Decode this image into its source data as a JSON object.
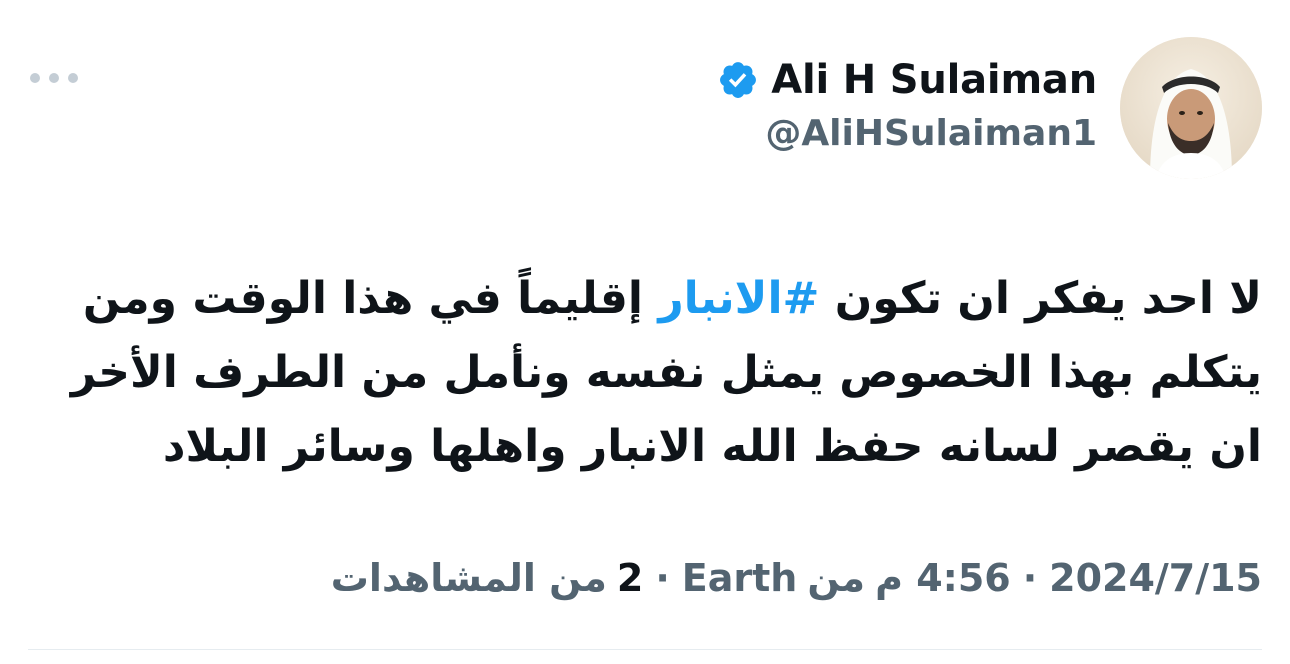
{
  "user": {
    "display_name": "Ali H Sulaiman",
    "handle": "@AliHSulaiman1",
    "verified": true,
    "verified_icon": "verified-badge-icon"
  },
  "tweet": {
    "text_line1_before": "لا احد يفكر ان تكون ",
    "hashtag": "#الانبار",
    "text_line1_after": " إقليماً في هذا الوقت ومن",
    "text_line2": "يتكلم بهذا الخصوص يمثل نفسه ونأمل من الطرف الأخر",
    "text_line3": "ان يقصر لسانه حفظ الله الانبار واهلها وسائر البلاد"
  },
  "meta": {
    "time": "4:56 م",
    "date": "2024/7/15",
    "from_label": "من",
    "location": "Earth",
    "separator": "·",
    "views_count": "2",
    "views_label": "من المشاهدات"
  },
  "colors": {
    "text": "#0f1419",
    "secondary": "#536471",
    "accent": "#1d9bf0"
  },
  "icons": {
    "more": "more-options-icon"
  }
}
